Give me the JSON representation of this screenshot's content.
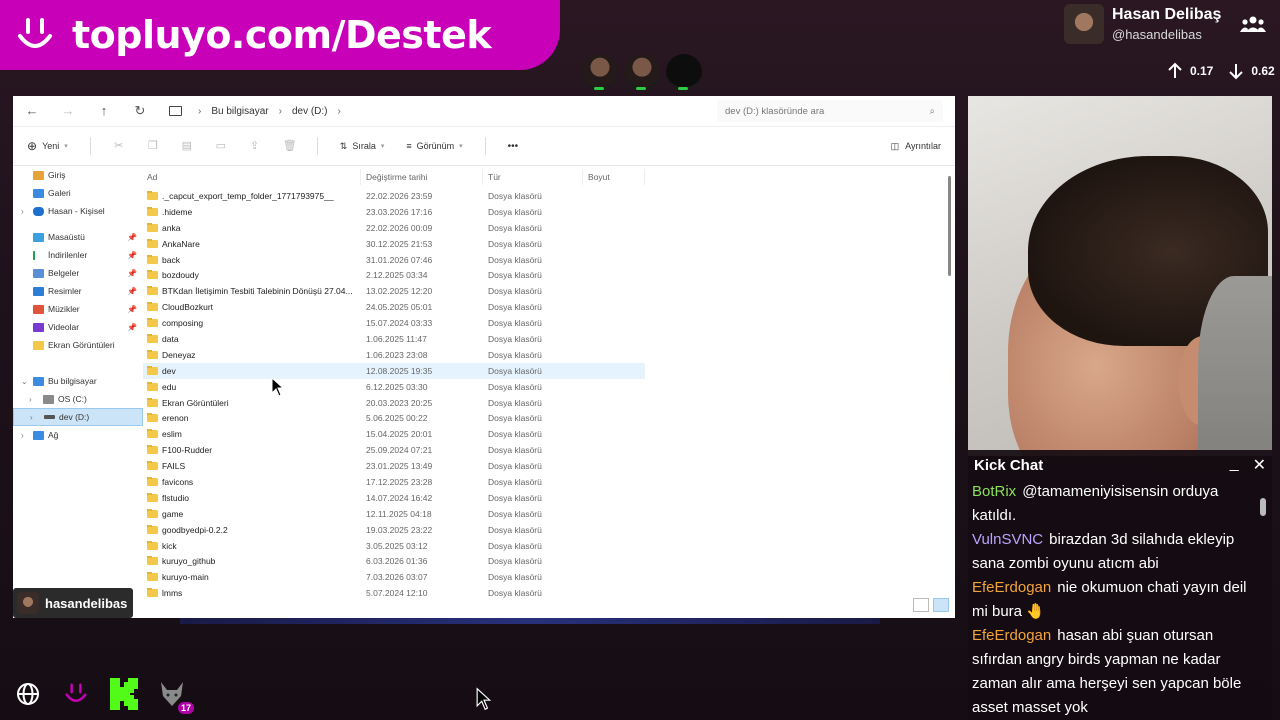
{
  "banner": {
    "text": "topluyo.com/Destek"
  },
  "profile": {
    "name": "Hasan Delibaş",
    "handle": "@hasandelibas"
  },
  "network": {
    "up": "0.17",
    "down": "0.62"
  },
  "explorer": {
    "breadcrumb": [
      "Bu bilgisayar",
      "dev (D:)"
    ],
    "search_placeholder": "dev (D:) klasöründe ara",
    "toolbar": {
      "new": "Yeni",
      "sort": "Sırala",
      "view": "Görünüm",
      "more": "•••",
      "details": "Ayrıntılar"
    },
    "nav": {
      "top": [
        "Giriş",
        "Galeri",
        "Hasan - Kişisel"
      ],
      "quick": [
        "Masaüstü",
        "İndirilenler",
        "Belgeler",
        "Resimler",
        "Müzikler",
        "Videolar",
        "Ekran Görüntüleri"
      ],
      "pc": "Bu bilgisayar",
      "drives": [
        "OS (C:)",
        "dev (D:)"
      ],
      "network": "Ağ"
    },
    "columns": {
      "name": "Ad",
      "date": "Değiştirme tarihi",
      "type": "Tür",
      "size": "Boyut"
    },
    "files": [
      {
        "name": "._capcut_export_temp_folder_1771793975__",
        "date": "22.02.2026 23:59",
        "type": "Dosya klasörü"
      },
      {
        "name": ".hideme",
        "date": "23.03.2026 17:16",
        "type": "Dosya klasörü"
      },
      {
        "name": "anka",
        "date": "22.02.2026 00:09",
        "type": "Dosya klasörü"
      },
      {
        "name": "AnkaNare",
        "date": "30.12.2025 21:53",
        "type": "Dosya klasörü"
      },
      {
        "name": "back",
        "date": "31.01.2026 07:46",
        "type": "Dosya klasörü"
      },
      {
        "name": "bozdoudy",
        "date": "2.12.2025 03:34",
        "type": "Dosya klasörü"
      },
      {
        "name": "BTKdan İletişimin Tesbiti Talebinin Dönüşü 27.04...",
        "date": "13.02.2025 12:20",
        "type": "Dosya klasörü"
      },
      {
        "name": "CloudBozkurt",
        "date": "24.05.2025 05:01",
        "type": "Dosya klasörü"
      },
      {
        "name": "composing",
        "date": "15.07.2024 03:33",
        "type": "Dosya klasörü"
      },
      {
        "name": "data",
        "date": "1.06.2025 11:47",
        "type": "Dosya klasörü"
      },
      {
        "name": "Deneyaz",
        "date": "1.06.2023 23:08",
        "type": "Dosya klasörü"
      },
      {
        "name": "dev",
        "date": "12.08.2025 19:35",
        "type": "Dosya klasörü"
      },
      {
        "name": "edu",
        "date": "6.12.2025 03:30",
        "type": "Dosya klasörü"
      },
      {
        "name": "Ekran Görüntüleri",
        "date": "20.03.2023 20:25",
        "type": "Dosya klasörü"
      },
      {
        "name": "erenon",
        "date": "5.06.2025 00:22",
        "type": "Dosya klasörü"
      },
      {
        "name": "eslim",
        "date": "15.04.2025 20:01",
        "type": "Dosya klasörü"
      },
      {
        "name": "F100-Rudder",
        "date": "25.09.2024 07:21",
        "type": "Dosya klasörü"
      },
      {
        "name": "FAILS",
        "date": "23.01.2025 13:49",
        "type": "Dosya klasörü"
      },
      {
        "name": "favicons",
        "date": "17.12.2025 23:28",
        "type": "Dosya klasörü"
      },
      {
        "name": "flstudio",
        "date": "14.07.2024 16:42",
        "type": "Dosya klasörü"
      },
      {
        "name": "game",
        "date": "12.11.2025 04:18",
        "type": "Dosya klasörü"
      },
      {
        "name": "goodbyedpi-0.2.2",
        "date": "19.03.2025 23:22",
        "type": "Dosya klasörü"
      },
      {
        "name": "kick",
        "date": "3.05.2025 03:12",
        "type": "Dosya klasörü"
      },
      {
        "name": "kuruyo_github",
        "date": "6.03.2026 01:36",
        "type": "Dosya klasörü"
      },
      {
        "name": "kuruyo-main",
        "date": "7.03.2026 03:07",
        "type": "Dosya klasörü"
      },
      {
        "name": "lmms",
        "date": "5.07.2024 12:10",
        "type": "Dosya klasörü"
      }
    ]
  },
  "chat": {
    "title": "Kick Chat",
    "messages": [
      {
        "user": "BotRix",
        "color": "#8ee05a",
        "text": "@tamameniyisisensin orduya katıldı."
      },
      {
        "user": "VulnSVNC",
        "color": "#b9a4ff",
        "text": "birazdan 3d silahıda ekleyip sana zombi oyunu atıcm abi"
      },
      {
        "user": "EfeErdogan",
        "color": "#f2a43a",
        "text": "nie okumuon chati yayın deil mi bura 🤚"
      },
      {
        "user": "EfeErdogan",
        "color": "#f2a43a",
        "text": "hasan abi şuan otursan sıfırdan angry birds yapman ne kadar zaman alır ama herşeyi sen yapcan böle asset masset yok"
      }
    ]
  },
  "streamer_tag": "hasandelibas",
  "bottom": {
    "badge_count": "17"
  },
  "colors": {
    "banner": "#c800b8",
    "selection": "#cce4f7"
  }
}
